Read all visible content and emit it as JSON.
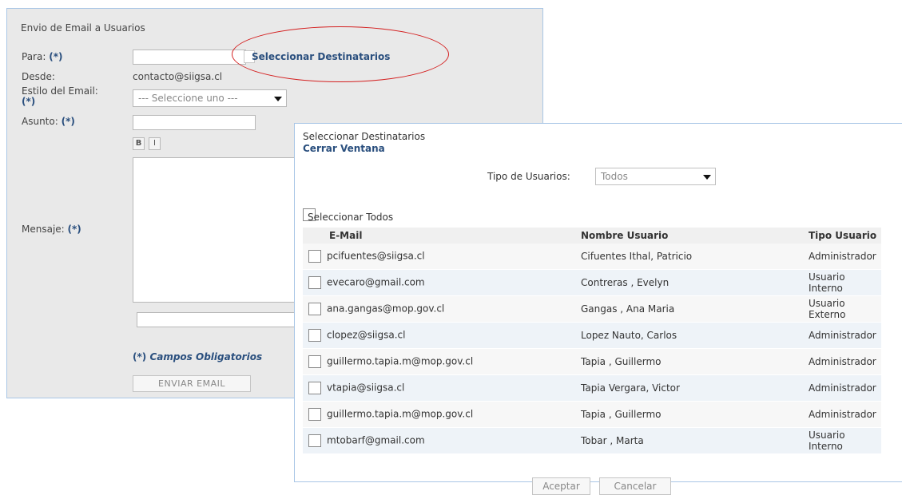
{
  "form": {
    "title": "Envio de Email a Usuarios",
    "para_label": "Para:",
    "req_mark": "(*)",
    "link_destinatarios": "Seleccionar Destinatarios",
    "desde_label": "Desde:",
    "desde_value": "contacto@siigsa.cl",
    "estilo_label": "Estilo del Email:",
    "estilo_placeholder": "--- Seleccione uno ---",
    "asunto_label": "Asunto:",
    "bold_btn": "B",
    "italic_btn": "I",
    "mensaje_label": "Mensaje:",
    "req_note_mark": "(*)",
    "req_note_text": "Campos Obligatorios",
    "send_button": "ENVIAR EMAIL"
  },
  "popup": {
    "title": "Seleccionar Destinatarios",
    "close_link": "Cerrar Ventana",
    "tipo_label": "Tipo de Usuarios:",
    "tipo_value": "Todos",
    "select_all": "Seleccionar Todos",
    "columns": [
      "E-Mail",
      "Nombre Usuario",
      "Tipo Usuario"
    ],
    "rows": [
      {
        "email": "pcifuentes@siigsa.cl",
        "name": "Cifuentes Ithal, Patricio",
        "type": "Administrador"
      },
      {
        "email": "evecaro@gmail.com",
        "name": "Contreras , Evelyn",
        "type": "Usuario Interno"
      },
      {
        "email": "ana.gangas@mop.gov.cl",
        "name": "Gangas , Ana Maria",
        "type": "Usuario Externo"
      },
      {
        "email": "clopez@siigsa.cl",
        "name": "Lopez Nauto, Carlos",
        "type": "Administrador"
      },
      {
        "email": "guillermo.tapia.m@mop.gov.cl",
        "name": "Tapia , Guillermo",
        "type": "Administrador"
      },
      {
        "email": "vtapia@siigsa.cl",
        "name": "Tapia Vergara, Victor",
        "type": "Administrador"
      },
      {
        "email": "guillermo.tapia.m@mop.gov.cl",
        "name": "Tapia , Guillermo",
        "type": "Administrador"
      },
      {
        "email": "mtobarf@gmail.com",
        "name": "Tobar , Marta",
        "type": "Usuario Interno"
      }
    ],
    "accept_button": "Aceptar",
    "cancel_button": "Cancelar"
  },
  "colors": {
    "link": "#2a4f7e",
    "annotation": "#d42020",
    "panel_bg": "#e9e9e9",
    "panel_border": "#a9c6e6"
  }
}
